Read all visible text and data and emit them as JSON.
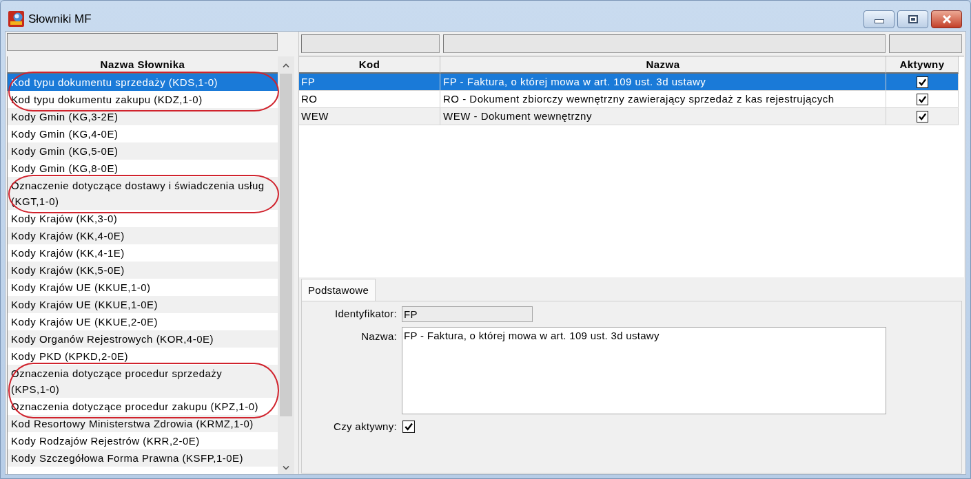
{
  "window": {
    "title": "Słowniki MF"
  },
  "dictionary_list": {
    "header": "Nazwa Słownika",
    "items": [
      {
        "label": "Kod typu dokumentu sprzedaży (KDS,1-0)",
        "selected": true,
        "marked": true
      },
      {
        "label": "Kod typu dokumentu zakupu (KDZ,1-0)",
        "selected": false,
        "marked": true
      },
      {
        "label": "Kody Gmin (KG,3-2E)",
        "selected": false,
        "marked": false
      },
      {
        "label": "Kody Gmin (KG,4-0E)",
        "selected": false,
        "marked": false
      },
      {
        "label": "Kody Gmin (KG,5-0E)",
        "selected": false,
        "marked": false
      },
      {
        "label": "Kody Gmin (KG,8-0E)",
        "selected": false,
        "marked": false
      },
      {
        "label": "Oznaczenie dotyczące dostawy i świadczenia usług (KGT,1-0)",
        "selected": false,
        "marked": true
      },
      {
        "label": "Kody Krajów (KK,3-0)",
        "selected": false,
        "marked": false
      },
      {
        "label": "Kody Krajów (KK,4-0E)",
        "selected": false,
        "marked": false
      },
      {
        "label": "Kody Krajów (KK,4-1E)",
        "selected": false,
        "marked": false
      },
      {
        "label": "Kody Krajów (KK,5-0E)",
        "selected": false,
        "marked": false
      },
      {
        "label": "Kody Krajów UE (KKUE,1-0)",
        "selected": false,
        "marked": false
      },
      {
        "label": "Kody Krajów UE (KKUE,1-0E)",
        "selected": false,
        "marked": false
      },
      {
        "label": "Kody Krajów UE (KKUE,2-0E)",
        "selected": false,
        "marked": false
      },
      {
        "label": "Kody Organów Rejestrowych (KOR,4-0E)",
        "selected": false,
        "marked": false
      },
      {
        "label": "Kody PKD (KPKD,2-0E)",
        "selected": false,
        "marked": false
      },
      {
        "label": "Oznaczenia dotyczące procedur sprzedaży (KPS,1-0)",
        "selected": false,
        "marked": true
      },
      {
        "label": "Oznaczenia dotyczące procedur zakupu (KPZ,1-0)",
        "selected": false,
        "marked": true
      },
      {
        "label": "Kod Resortowy Ministerstwa Zdrowia (KRMZ,1-0)",
        "selected": false,
        "marked": false
      },
      {
        "label": "Kody Rodzajów Rejestrów (KRR,2-0E)",
        "selected": false,
        "marked": false
      },
      {
        "label": "Kody Szczegółowa Forma Prawna (KSFP,1-0E)",
        "selected": false,
        "marked": false
      }
    ]
  },
  "entries_table": {
    "columns": [
      {
        "label": "Kod"
      },
      {
        "label": "Nazwa"
      },
      {
        "label": "Aktywny"
      }
    ],
    "rows": [
      {
        "code": "FP",
        "name": "FP - Faktura, o której mowa w art. 109 ust. 3d ustawy",
        "active": true,
        "selected": true
      },
      {
        "code": "RO",
        "name": "RO - Dokument zbiorczy wewnętrzny zawierający sprzedaż z kas rejestrujących",
        "active": true,
        "selected": false
      },
      {
        "code": "WEW",
        "name": "WEW - Dokument wewnętrzny",
        "active": true,
        "selected": false
      }
    ]
  },
  "detail": {
    "tabs": [
      {
        "label": "Podstawowe",
        "selected": true
      }
    ],
    "fields": [
      {
        "kind": "text",
        "label": "Identyfikator:",
        "value": "FP"
      },
      {
        "kind": "textarea",
        "label": "Nazwa:",
        "value": "FP - Faktura, o której mowa w art. 109 ust. 3d ustawy"
      },
      {
        "kind": "checkbox",
        "label": "Czy aktywny:",
        "checked": true
      }
    ]
  }
}
